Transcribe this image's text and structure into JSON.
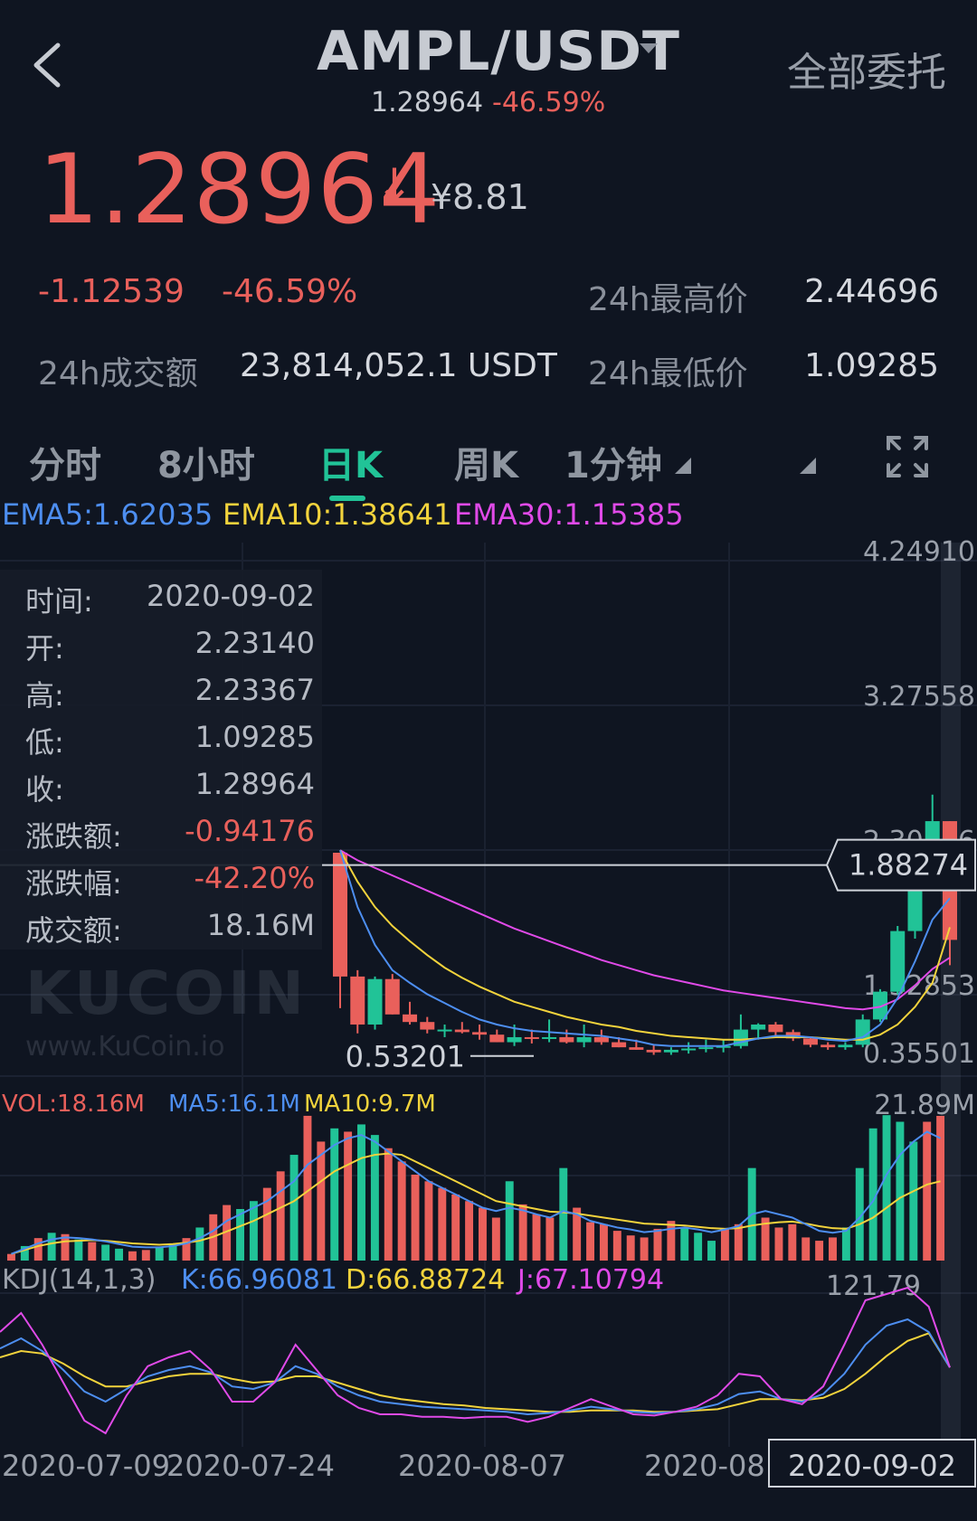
{
  "header": {
    "pair": "AMPL/USDT",
    "orders_label": "全部委托",
    "sub_price": "1.28964",
    "sub_change": "-46.59%"
  },
  "ticker": {
    "price": "1.28964",
    "arrow": "↓",
    "cny": "¥8.81",
    "change_abs": "-1.12539",
    "change_pct": "-46.59%",
    "high_label": "24h最高价",
    "high_value": "2.44696",
    "turnover_label": "24h成交额",
    "turnover_value": "23,814,052.1 USDT",
    "low_label": "24h最低价",
    "low_value": "1.09285"
  },
  "tabs": [
    "分时",
    "8小时",
    "日K",
    "周K",
    "1分钟"
  ],
  "active_tab": "日K",
  "indicators": {
    "ema5": "EMA5:1.62035",
    "ema10": "EMA10:1.38641",
    "ema30": "EMA30:1.15385",
    "vol": "VOL:18.16M",
    "ma5": "MA5:16.1M",
    "ma10": "MA10:9.7M",
    "kdj": "KDJ(14,1,3)",
    "k": "K:66.96081",
    "d": "D:66.88724",
    "j": "J:67.10794"
  },
  "tooltip": {
    "rows": [
      {
        "label": "时间:",
        "value": "2020-09-02"
      },
      {
        "label": "开:",
        "value": "2.23140"
      },
      {
        "label": "高:",
        "value": "2.23367"
      },
      {
        "label": "低:",
        "value": "1.09285"
      },
      {
        "label": "收:",
        "value": "1.28964"
      },
      {
        "label": "涨跌额:",
        "value": "-0.94176"
      },
      {
        "label": "涨跌幅:",
        "value": "-42.20%"
      },
      {
        "label": "成交额:",
        "value": "18.16M"
      }
    ]
  },
  "watermark": {
    "logo": "KUCOIN",
    "url": "www.KuCoin.io"
  },
  "colors": {
    "up": "#21c397",
    "down": "#e9605b",
    "ema5": "#4d8ef0",
    "ema10": "#f2d33c",
    "ema30": "#e04ae8",
    "bg": "#0f1521"
  },
  "chart_data": {
    "type": "candlestick",
    "price_axis": [
      "4.24910",
      "3.27558",
      "2.30206",
      "1.32853",
      "0.35501"
    ],
    "price_range": [
      0.35501,
      4.2491
    ],
    "volume_axis_max": "21.89M",
    "kdj_axis_max": "121.79",
    "crosshair_price": "1.88274",
    "min_price_label": "0.53201",
    "x_labels": [
      "2020-07-09",
      "2020-07-24",
      "2020-08-07",
      "2020-08",
      "2020-09-02"
    ],
    "candles": [
      [
        1.98,
        1.98,
        0.75,
        1.0
      ],
      [
        1.0,
        1.05,
        0.55,
        0.62
      ],
      [
        0.62,
        1.0,
        0.58,
        0.98
      ],
      [
        0.98,
        1.02,
        0.7,
        0.7
      ],
      [
        0.7,
        0.8,
        0.62,
        0.64
      ],
      [
        0.64,
        0.68,
        0.55,
        0.58
      ],
      [
        0.58,
        0.62,
        0.52,
        0.58
      ],
      [
        0.58,
        0.64,
        0.55,
        0.56
      ],
      [
        0.56,
        0.62,
        0.5,
        0.54
      ],
      [
        0.54,
        0.58,
        0.48,
        0.48
      ],
      [
        0.48,
        0.62,
        0.45,
        0.52
      ],
      [
        0.52,
        0.58,
        0.47,
        0.51
      ],
      [
        0.51,
        0.66,
        0.48,
        0.52
      ],
      [
        0.52,
        0.58,
        0.47,
        0.48
      ],
      [
        0.48,
        0.62,
        0.44,
        0.52
      ],
      [
        0.52,
        0.58,
        0.46,
        0.48
      ],
      [
        0.48,
        0.52,
        0.44,
        0.44
      ],
      [
        0.44,
        0.5,
        0.42,
        0.42
      ],
      [
        0.42,
        0.46,
        0.38,
        0.4
      ],
      [
        0.4,
        0.44,
        0.38,
        0.42
      ],
      [
        0.42,
        0.48,
        0.39,
        0.43
      ],
      [
        0.43,
        0.5,
        0.4,
        0.44
      ],
      [
        0.44,
        0.5,
        0.4,
        0.45
      ],
      [
        0.45,
        0.7,
        0.43,
        0.58
      ],
      [
        0.58,
        0.63,
        0.5,
        0.62
      ],
      [
        0.62,
        0.64,
        0.53,
        0.56
      ],
      [
        0.56,
        0.58,
        0.49,
        0.51
      ],
      [
        0.51,
        0.52,
        0.44,
        0.46
      ],
      [
        0.46,
        0.48,
        0.42,
        0.44
      ],
      [
        0.44,
        0.48,
        0.42,
        0.46
      ],
      [
        0.46,
        0.7,
        0.44,
        0.66
      ],
      [
        0.66,
        0.9,
        0.64,
        0.88
      ],
      [
        0.88,
        1.4,
        0.86,
        1.36
      ],
      [
        1.36,
        1.9,
        1.3,
        1.85
      ],
      [
        1.85,
        2.44,
        1.75,
        2.23
      ],
      [
        2.23,
        2.23,
        1.09,
        1.29
      ]
    ],
    "ema5": [
      2.0,
      1.55,
      1.25,
      1.05,
      0.95,
      0.86,
      0.79,
      0.72,
      0.66,
      0.62,
      0.59,
      0.57,
      0.56,
      0.55,
      0.54,
      0.53,
      0.51,
      0.49,
      0.46,
      0.45,
      0.45,
      0.45,
      0.45,
      0.48,
      0.51,
      0.53,
      0.53,
      0.52,
      0.5,
      0.49,
      0.52,
      0.62,
      0.83,
      1.12,
      1.45,
      1.62
    ],
    "ema10": [
      2.0,
      1.75,
      1.55,
      1.4,
      1.28,
      1.17,
      1.07,
      0.99,
      0.92,
      0.86,
      0.8,
      0.76,
      0.72,
      0.68,
      0.65,
      0.62,
      0.6,
      0.57,
      0.55,
      0.53,
      0.52,
      0.51,
      0.5,
      0.5,
      0.51,
      0.52,
      0.52,
      0.52,
      0.51,
      0.5,
      0.5,
      0.54,
      0.62,
      0.76,
      0.95,
      1.39
    ],
    "ema30": [
      2.0,
      1.92,
      1.86,
      1.8,
      1.74,
      1.68,
      1.62,
      1.56,
      1.5,
      1.44,
      1.38,
      1.33,
      1.28,
      1.23,
      1.18,
      1.13,
      1.09,
      1.05,
      1.01,
      0.98,
      0.95,
      0.92,
      0.89,
      0.87,
      0.85,
      0.83,
      0.81,
      0.79,
      0.77,
      0.75,
      0.74,
      0.76,
      0.82,
      0.93,
      1.06,
      1.15
    ],
    "volume": [
      1.0,
      2.2,
      3.4,
      4.2,
      4.0,
      3.2,
      2.8,
      2.4,
      1.8,
      1.4,
      1.6,
      2.0,
      2.6,
      3.4,
      5.0,
      7.0,
      8.4,
      7.8,
      9.0,
      11.0,
      13.5,
      16.0,
      21.9,
      18.0,
      20.0,
      19.5,
      20.6,
      19.0,
      17.0,
      15.0,
      13.0,
      12.0,
      11.0,
      10.0,
      9.0,
      8.0,
      6.5,
      12.0,
      8.5,
      7.0,
      6.5,
      14.0,
      8.0,
      5.8,
      5.5,
      4.5,
      3.8,
      3.5,
      4.8,
      6.0,
      5.0,
      4.2,
      3.0,
      4.8,
      5.5,
      14.0,
      6.5,
      5.0,
      5.5,
      3.5,
      3.0,
      3.5,
      5.0,
      14.0,
      20.0,
      22.0,
      21.0,
      18.0,
      21.0,
      21.89
    ],
    "vol_up": [
      0,
      1,
      0,
      1,
      0,
      1,
      0,
      1,
      1,
      0,
      0,
      1,
      1,
      0,
      1,
      0,
      0,
      1,
      1,
      0,
      0,
      1,
      0,
      0,
      1,
      0,
      1,
      1,
      0,
      0,
      0,
      0,
      0,
      0,
      0,
      0,
      0,
      1,
      0,
      0,
      0,
      1,
      0,
      0,
      0,
      0,
      0,
      0,
      0,
      0,
      1,
      1,
      1,
      0,
      0,
      1,
      0,
      0,
      0,
      0,
      0,
      0,
      1,
      1,
      1,
      1,
      1,
      1,
      0,
      0
    ],
    "ma5": [
      1.0,
      1.8,
      2.6,
      3.2,
      3.5,
      3.4,
      3.2,
      2.9,
      2.5,
      2.1,
      2.0,
      2.0,
      2.2,
      2.6,
      3.4,
      4.5,
      6.0,
      7.0,
      8.0,
      9.0,
      10.5,
      12.0,
      14.5,
      16.0,
      17.5,
      18.5,
      19.0,
      18.0,
      16.5,
      15.0,
      13.5,
      12.0,
      11.0,
      10.0,
      9.0,
      8.0,
      7.5,
      8.0,
      7.6,
      7.0,
      6.5,
      7.5,
      7.0,
      6.0,
      5.5,
      5.0,
      4.7,
      4.3,
      4.5,
      4.8,
      5.0,
      4.7,
      4.3,
      4.7,
      5.2,
      7.0,
      7.5,
      7.0,
      6.5,
      5.5,
      4.5,
      4.2,
      4.5,
      6.5,
      9.0,
      13.0,
      16.0,
      18.0,
      19.5,
      18.5
    ],
    "ma10": [
      1.0,
      1.6,
      2.2,
      2.6,
      2.9,
      3.0,
      3.1,
      3.0,
      2.8,
      2.6,
      2.5,
      2.4,
      2.5,
      2.7,
      3.0,
      3.6,
      4.4,
      5.2,
      6.0,
      7.0,
      8.0,
      9.0,
      10.5,
      12.0,
      13.5,
      14.5,
      15.5,
      16.0,
      16.2,
      16.0,
      15.0,
      14.0,
      13.0,
      12.0,
      11.0,
      10.0,
      9.0,
      8.6,
      8.2,
      7.8,
      7.4,
      7.3,
      7.1,
      6.8,
      6.5,
      6.2,
      5.9,
      5.6,
      5.5,
      5.4,
      5.3,
      5.1,
      4.9,
      4.8,
      4.9,
      5.3,
      5.6,
      5.8,
      5.9,
      5.6,
      5.2,
      4.9,
      4.8,
      5.5,
      6.5,
      8.0,
      9.5,
      10.5,
      11.5,
      12.0
    ],
    "k": [
      82,
      90,
      80,
      65,
      48,
      40,
      50,
      60,
      65,
      68,
      63,
      52,
      50,
      55,
      68,
      62,
      52,
      45,
      40,
      38,
      36,
      35,
      34,
      33,
      32,
      30,
      31,
      33,
      36,
      34,
      32,
      31,
      32,
      34,
      38,
      46,
      48,
      42,
      40,
      46,
      62,
      85,
      100,
      105,
      95,
      67
    ],
    "d": [
      75,
      80,
      78,
      70,
      60,
      52,
      52,
      56,
      60,
      62,
      62,
      58,
      55,
      56,
      60,
      60,
      55,
      50,
      45,
      42,
      40,
      38,
      37,
      35,
      34,
      33,
      32,
      32,
      33,
      33,
      33,
      32,
      32,
      33,
      34,
      38,
      42,
      42,
      41,
      43,
      50,
      62,
      76,
      88,
      94,
      67
    ],
    "j": [
      95,
      110,
      85,
      55,
      25,
      15,
      45,
      68,
      75,
      80,
      65,
      40,
      40,
      55,
      85,
      65,
      45,
      35,
      30,
      30,
      28,
      28,
      27,
      28,
      28,
      24,
      28,
      35,
      42,
      36,
      30,
      29,
      32,
      36,
      45,
      62,
      60,
      42,
      38,
      52,
      85,
      120,
      125,
      130,
      115,
      67
    ]
  }
}
